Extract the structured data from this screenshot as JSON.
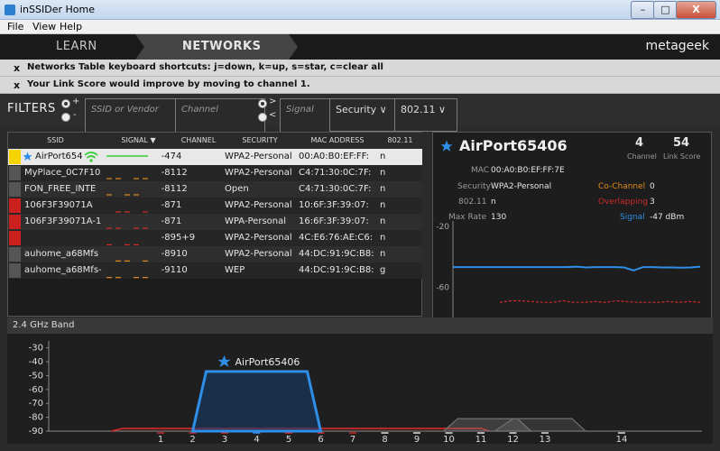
{
  "window": {
    "title": "inSSIDer Home",
    "min": "–",
    "max": "□",
    "close": "X"
  },
  "menu": {
    "file": "File",
    "view": "View",
    "help": "Help"
  },
  "nav": {
    "learn": "LEARN",
    "networks": "NETWORKS",
    "brand": "metageek"
  },
  "notices": [
    {
      "close": "x",
      "text": "Networks Table keyboard shortcuts: j=down, k=up, s=star, c=clear all"
    },
    {
      "close": "x",
      "text": "Your Link Score would improve by moving to channel 1."
    }
  ],
  "filters": {
    "label": "FILTERS",
    "plus": "+",
    "minus": "-",
    "gt": ">",
    "lt": "<",
    "ssid_placeholder": "SSID or Vendor",
    "channel_placeholder": "Channel",
    "signal_placeholder": "Signal",
    "security": "Security",
    "mode": "802.11"
  },
  "table": {
    "headers": {
      "ssid": "SSID",
      "signal": "SIGNAL ▼",
      "channel": "CHANNEL",
      "security": "SECURITY",
      "mac": "MAC ADDRESS",
      "mode": "802.11"
    },
    "rows": [
      {
        "ssid": "AirPort654",
        "signal": "-47",
        "channel": "4",
        "security": "WPA2-Personal",
        "mac": "00:A0:B0:EF:FF:",
        "mode": "n",
        "color": "#f5d400"
      },
      {
        "ssid": "MyPlace_0C7F10",
        "signal": "-81",
        "channel": "12",
        "security": "WPA2-Personal",
        "mac": "C4:71:30:0C:7F:",
        "mode": "n",
        "color": "#555555"
      },
      {
        "ssid": "FON_FREE_INTE",
        "signal": "-81",
        "channel": "12",
        "security": "Open",
        "mac": "C4:71:30:0C:7F:",
        "mode": "n",
        "color": "#555555"
      },
      {
        "ssid": "106F3F39071A",
        "signal": "-87",
        "channel": "1",
        "security": "WPA2-Personal",
        "mac": "10:6F:3F:39:07:",
        "mode": "n",
        "color": "#cc2020"
      },
      {
        "ssid": "106F3F39071A-1",
        "signal": "-87",
        "channel": "1",
        "security": "WPA-Personal",
        "mac": "16:6F:3F:39:07:",
        "mode": "n",
        "color": "#cc2020"
      },
      {
        "ssid": "",
        "signal": "-89",
        "channel": "5+9",
        "security": "WPA2-Personal",
        "mac": "4C:E6:76:AE:C6:",
        "mode": "n",
        "color": "#cc2020"
      },
      {
        "ssid": "auhome_a68Mfs",
        "signal": "-89",
        "channel": "10",
        "security": "WPA2-Personal",
        "mac": "44:DC:91:9C:B8:",
        "mode": "n",
        "color": "#555555"
      },
      {
        "ssid": "auhome_a68Mfs-",
        "signal": "-91",
        "channel": "10",
        "security": "WEP",
        "mac": "44:DC:91:9C:B8:",
        "mode": "g",
        "color": "#555555"
      }
    ]
  },
  "details": {
    "name": "AirPort65406",
    "channel_value": "4",
    "channel_label": "Channel",
    "score_value": "54",
    "score_label": "Link Score",
    "mac_label": "MAC",
    "mac_value": "00:A0:B0:EF:FF:7E",
    "security_label": "Security",
    "security_value": "WPA2-Personal",
    "mode_label": "802.11",
    "mode_value": "n",
    "rate_label": "Max Rate",
    "rate_value": "130",
    "cochannel_label": "Co-Channel",
    "cochannel_value": "0",
    "overlapping_label": "Overlapping",
    "overlapping_value": "3",
    "signal_label": "Signal",
    "signal_value": "-47 dBm",
    "colors": {
      "cochannel": "#e08a1e",
      "overlapping": "#d02a2a",
      "signal": "#2f8fe8"
    }
  },
  "band": {
    "title": "2.4 GHz Band"
  },
  "chart_data": [
    {
      "type": "line",
      "ylim": [
        -20,
        -80
      ],
      "yticks": [
        "-20",
        "-60"
      ],
      "series": [
        {
          "values": [
            -46.8,
            -46.8,
            -46.8,
            -46.8,
            -46.8,
            -46.8,
            -46.8,
            -46.8,
            -46.8,
            -46.8,
            -46.8,
            -46.8,
            -46.8,
            -46.5,
            -47,
            -46.8,
            -46.8,
            -46.8,
            -47,
            -49,
            -46.8,
            -46.8,
            -47,
            -47,
            -47.2,
            -47,
            -46.5
          ]
        },
        {
          "values": [
            -70,
            -69,
            -69,
            -69.5,
            -70,
            -70,
            -69,
            -70,
            -70,
            -69.5,
            -70,
            -69,
            -69.5,
            -70,
            -70,
            -70,
            -69.5,
            -70,
            -69.5,
            -70
          ]
        }
      ],
      "colors": [
        "#2f8fe8",
        "#d02a2a"
      ]
    },
    {
      "type": "area",
      "xlabel": "",
      "ylabel": "",
      "ylim": [
        -90,
        -25
      ],
      "yticks": [
        "-30",
        "-40",
        "-50",
        "-60",
        "-70",
        "-80",
        "-90"
      ],
      "xticks": [
        "1",
        "2",
        "3",
        "4",
        "5",
        "6",
        "7",
        "8",
        "9",
        "10",
        "11",
        "12",
        "13",
        "14"
      ],
      "annotation": "AirPort65406",
      "series": [
        {
          "channel": "1-7",
          "level": -88,
          "color": "#d02a2a"
        },
        {
          "channel": "4",
          "level": -47,
          "color": "#2f8fe8"
        },
        {
          "channel": "10-14",
          "level": -81,
          "color": "#707070"
        }
      ]
    }
  ]
}
